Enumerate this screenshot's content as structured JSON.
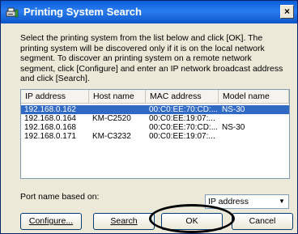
{
  "window": {
    "title": "Printing System Search",
    "close_symbol": "×",
    "app_icon": "network-printer-icon"
  },
  "instructions": "Select the printing system from the list below and click [OK]. The printing system will be discovered only if it is on the local network segment. To discover an printing system on a remote network segment, click [Configure] and enter an IP network broadcast address and click [Search].",
  "list": {
    "columns": [
      "IP address",
      "Host name",
      "MAC address",
      "Model name"
    ],
    "rows": [
      {
        "ip": "192.168.0.162",
        "host": "",
        "mac": "00:C0:EE:70:CD:...",
        "model": "NS-30",
        "selected": true
      },
      {
        "ip": "192.168.0.164",
        "host": "KM-C2520",
        "mac": "00:C0:EE:19:07:...",
        "model": "",
        "selected": false
      },
      {
        "ip": "192.168.0.168",
        "host": "",
        "mac": "00:C0:EE:70:CD:...",
        "model": "NS-30",
        "selected": false
      },
      {
        "ip": "192.168.0.171",
        "host": "KM-C3232",
        "mac": "00:C0:EE:19:07:...",
        "model": "",
        "selected": false
      }
    ]
  },
  "port": {
    "label": "Port name based on:",
    "selected": "IP address",
    "arrow": "▼"
  },
  "buttons": {
    "configure": "Configure...",
    "search": "Search",
    "ok": "OK",
    "cancel": "Cancel"
  },
  "colors": {
    "selection": "#316ac5",
    "titlebar": "#0a5fd8",
    "annotation_circle": "#000000"
  }
}
